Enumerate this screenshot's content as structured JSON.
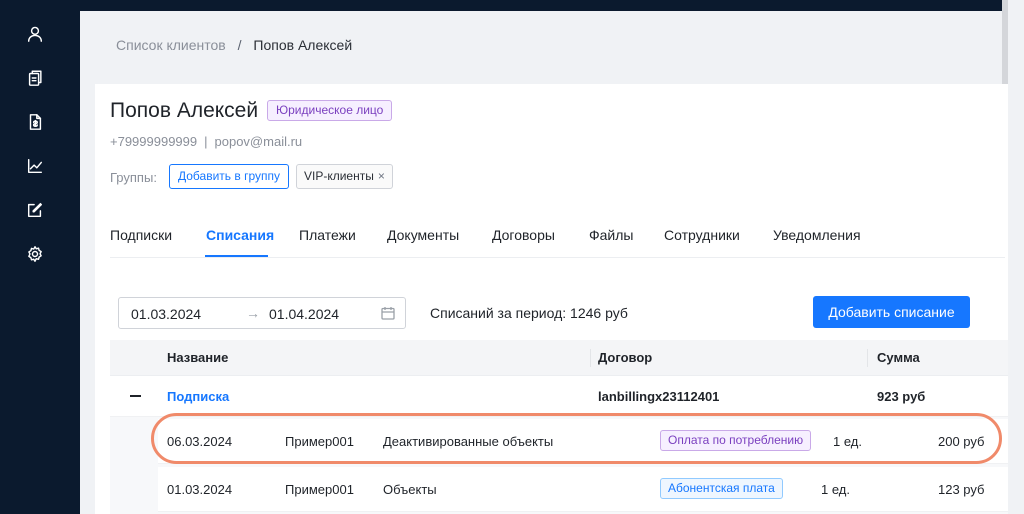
{
  "sidebar": {
    "icons": [
      "user-icon",
      "documents-icon",
      "invoice-icon",
      "chart-icon",
      "edit-icon",
      "gear-icon"
    ]
  },
  "breadcrumb": {
    "root": "Список клиентов",
    "separator": "/",
    "current": "Попов Алексей"
  },
  "client": {
    "name": "Попов Алексей",
    "type_badge": "Юридическое лицо",
    "phone": "+79999999999",
    "contact_separator": "|",
    "email": "popov@mail.ru",
    "groups_label": "Группы:",
    "add_group_label": "Добавить в группу",
    "group_tag": "VIP-клиенты",
    "group_tag_remove": "×"
  },
  "tabs": [
    {
      "label": "Подписки",
      "active": false
    },
    {
      "label": "Списания",
      "active": true
    },
    {
      "label": "Платежи",
      "active": false
    },
    {
      "label": "Документы",
      "active": false
    },
    {
      "label": "Договоры",
      "active": false
    },
    {
      "label": "Файлы",
      "active": false
    },
    {
      "label": "Сотрудники",
      "active": false
    },
    {
      "label": "Уведомления",
      "active": false
    }
  ],
  "filters": {
    "date_from": "01.03.2024",
    "arrow": "→",
    "date_to": "01.04.2024",
    "period_total": "Списаний за период: 1246 руб",
    "add_button": "Добавить списание"
  },
  "table": {
    "columns": {
      "name": "Название",
      "contract": "Договор",
      "sum": "Сумма"
    },
    "group": {
      "name": "Подписка",
      "contract": "lanbillingx23112401",
      "sum": "923 руб"
    },
    "rows": [
      {
        "date": "06.03.2024",
        "code": "Пример001",
        "object": "Деактивированные объекты",
        "type": "Оплата по потреблению",
        "qty": "1 ед.",
        "sum": "200 руб"
      },
      {
        "date": "01.03.2024",
        "code": "Пример001",
        "object": "Объекты",
        "type": "Абонентская плата",
        "qty": "1 ед.",
        "sum": "123 руб"
      }
    ]
  },
  "colors": {
    "accent": "#1677ff",
    "sidebar": "#0b1a2e",
    "highlight": "#f08a6a"
  }
}
